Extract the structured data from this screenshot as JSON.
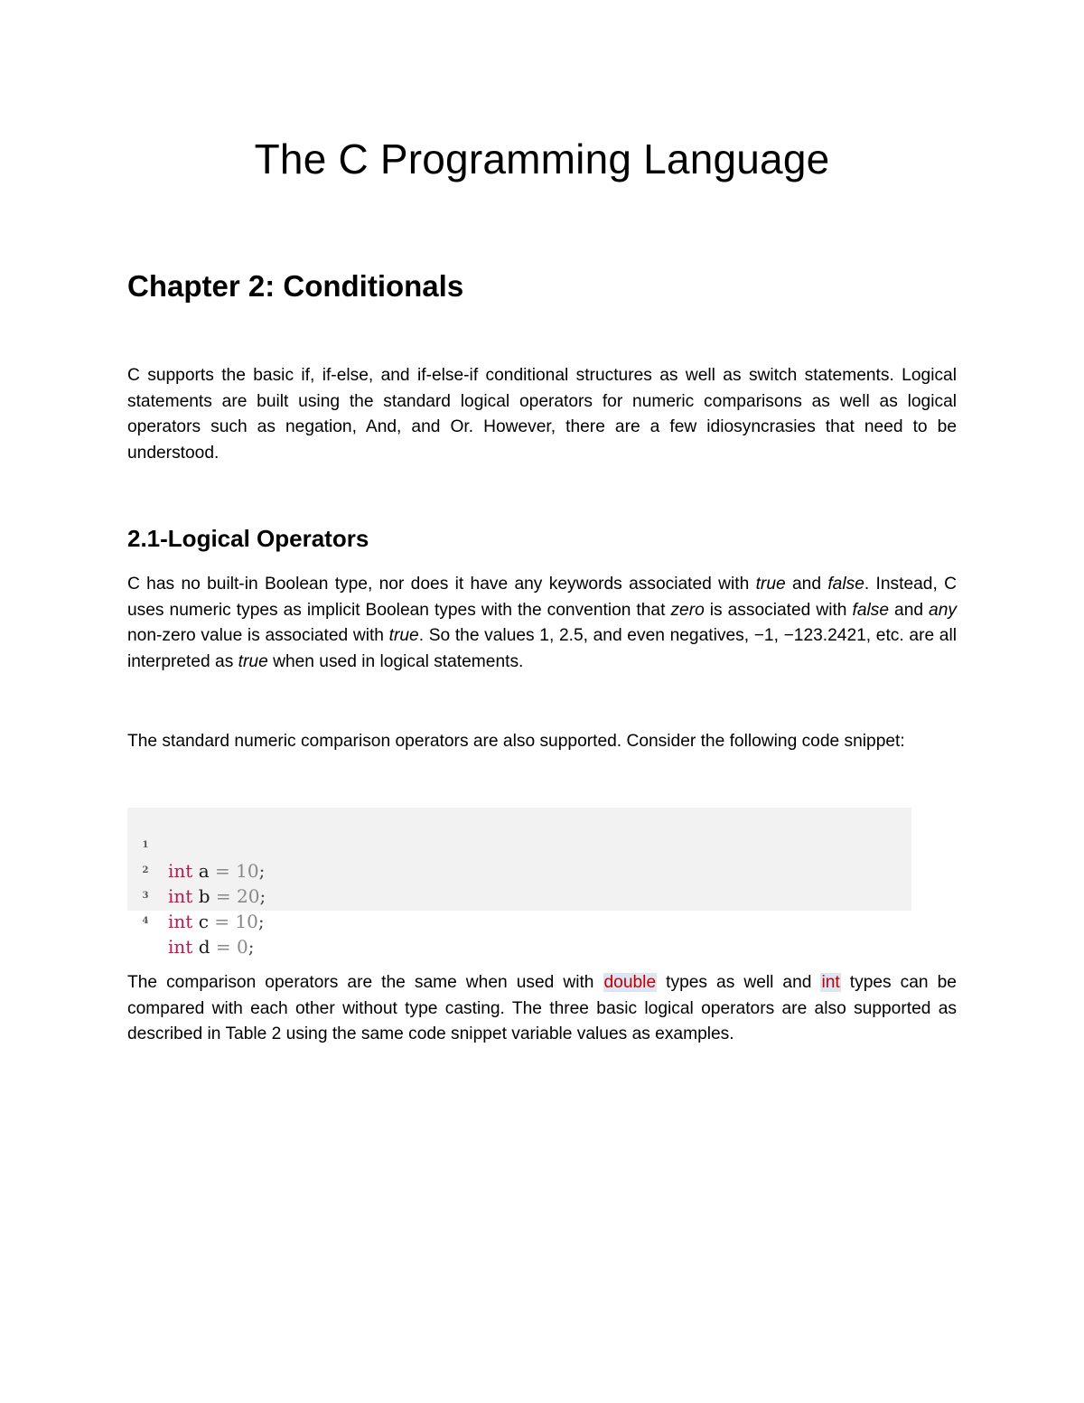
{
  "document": {
    "title": "The C Programming Language",
    "chapter_heading": "Chapter 2: Conditionals",
    "intro_paragraph": "C supports the basic if, if-else, and if-else-if conditional structures as well as switch statements. Logical statements are built using the standard logical operators for numeric comparisons as well as logical operators such as negation, And, and Or. However, there are a few idiosyncrasies that need to be understood.",
    "section_heading": "2.1-Logical Operators",
    "bool_paragraph": {
      "parts": [
        {
          "text": "C has no built-in Boolean type, nor does it have any keywords associated with ",
          "italic": false
        },
        {
          "text": "true",
          "italic": true
        },
        {
          "text": " and ",
          "italic": false
        },
        {
          "text": "false",
          "italic": true
        },
        {
          "text": ". Instead, C uses numeric types as implicit Boolean types with the convention that ",
          "italic": false
        },
        {
          "text": "zero",
          "italic": true
        },
        {
          "text": " is associated with ",
          "italic": false
        },
        {
          "text": "false",
          "italic": true
        },
        {
          "text": " and ",
          "italic": false
        },
        {
          "text": "any",
          "italic": true
        },
        {
          "text": " non-zero value is associated with ",
          "italic": false
        },
        {
          "text": "true",
          "italic": true
        },
        {
          "text": ". So the values 1, 2.5, and even negatives, −1, −123.2421, etc. are all interpreted as ",
          "italic": false
        },
        {
          "text": "true",
          "italic": true
        },
        {
          "text": " when used in logical statements.",
          "italic": false
        }
      ]
    },
    "compare_paragraph": "The standard numeric comparison operators are also supported. Consider the following code snippet:",
    "code_snippet": {
      "lines": [
        {
          "number": "1",
          "keyword": "int",
          "variable": "a",
          "operator": "=",
          "value": "10",
          "terminator": ";"
        },
        {
          "number": "2",
          "keyword": "int",
          "variable": "b",
          "operator": "=",
          "value": "20",
          "terminator": ";"
        },
        {
          "number": "3",
          "keyword": "int",
          "variable": "c",
          "operator": "=",
          "value": "10",
          "terminator": ";"
        },
        {
          "number": "4",
          "keyword": "int",
          "variable": "d",
          "operator": "=",
          "value": "0",
          "terminator": ";"
        }
      ]
    },
    "types_paragraph": {
      "before_double": "The comparison operators are the same when used with ",
      "double_keyword": "double",
      "between": " types as well and ",
      "int_keyword": "int",
      "after_int": " types can be compared with each other without type casting. The three basic logical operators are also supported as described in Table 2 using the same code snippet variable values as examples."
    },
    "colors": {
      "keyword_red": "#c0184a",
      "inline_code_red": "#c00000",
      "inline_code_highlight": "#dde4f2",
      "code_background": "#f2f2f2"
    }
  }
}
